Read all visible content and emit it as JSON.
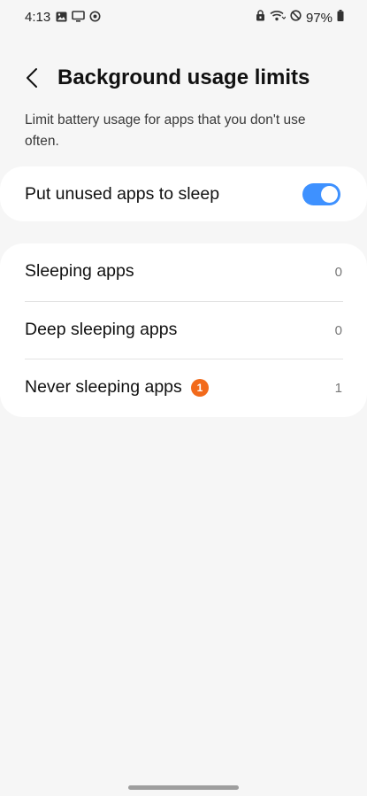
{
  "status_bar": {
    "time": "4:13",
    "battery": "97%",
    "left_icons": [
      "image-icon",
      "screen-icon",
      "sync-icon"
    ],
    "right_icons": [
      "lock-icon",
      "wifi-icon",
      "do-not-disturb-icon",
      "battery-icon"
    ]
  },
  "header": {
    "title": "Background usage limits",
    "back_icon": "chevron-left-icon"
  },
  "description": "Limit battery usage for apps that you don't use often.",
  "toggle_card": {
    "label": "Put unused apps to sleep",
    "enabled": true,
    "accent_color": "#3e91ff"
  },
  "list": [
    {
      "label": "Sleeping apps",
      "count": "0"
    },
    {
      "label": "Deep sleeping apps",
      "count": "0"
    },
    {
      "label": "Never sleeping apps",
      "count": "1",
      "badge": "1",
      "badge_color": "#f26a1b"
    }
  ]
}
